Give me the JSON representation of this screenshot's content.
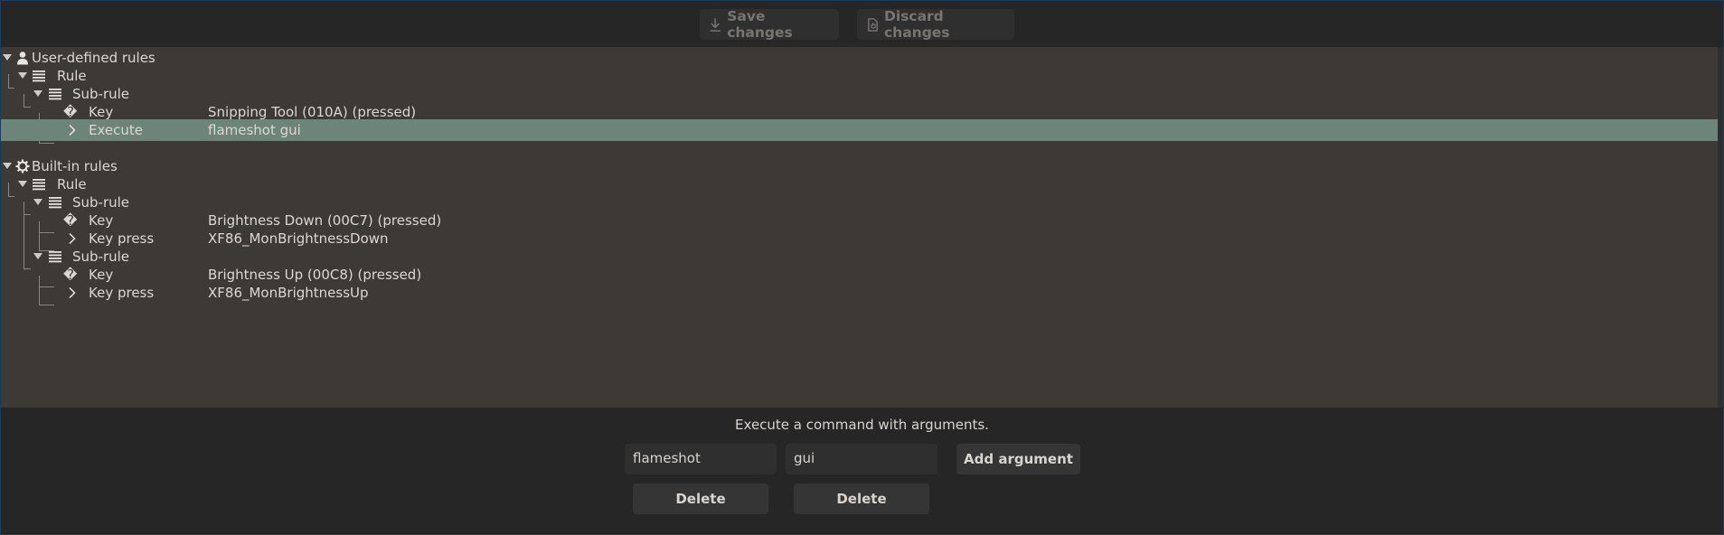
{
  "toolbar": {
    "save_label": "Save changes",
    "discard_label": "Discard changes"
  },
  "tree": {
    "user_defined": {
      "label": "User-defined rules",
      "rule_label": "Rule",
      "subrule_label": "Sub-rule",
      "key_label": "Key",
      "key_value": "Snipping Tool (010A) (pressed)",
      "execute_label": "Execute",
      "execute_value": "flameshot gui"
    },
    "builtin": {
      "label": "Built-in rules",
      "rule_label": "Rule",
      "subrule1_label": "Sub-rule",
      "key1_label": "Key",
      "key1_value": "Brightness Down (00C7) (pressed)",
      "keypress1_label": "Key press",
      "keypress1_value": "XF86_MonBrightnessDown",
      "subrule2_label": "Sub-rule",
      "key2_label": "Key",
      "key2_value": "Brightness Up (00C8) (pressed)",
      "keypress2_label": "Key press",
      "keypress2_value": "XF86_MonBrightnessUp"
    }
  },
  "editor": {
    "description": "Execute a command with arguments.",
    "arguments": [
      "flameshot",
      "gui"
    ],
    "add_argument_label": "Add argument",
    "delete_label": "Delete"
  },
  "icons": {
    "unknown_glyph": "�",
    "chevron": "❯"
  },
  "colors": {
    "selection": "#6b8679",
    "tree_background": "#3d3935",
    "window_background": "#262626"
  }
}
